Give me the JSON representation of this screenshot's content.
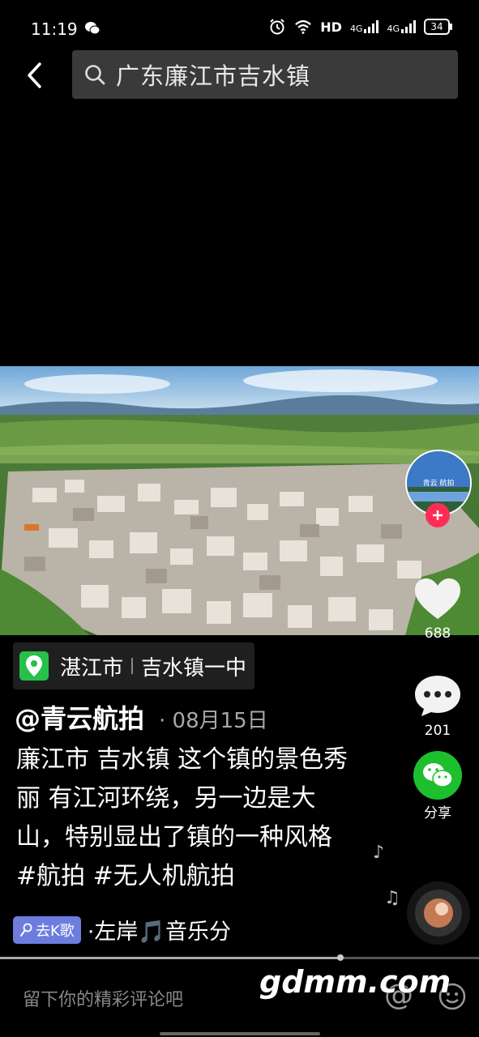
{
  "status_bar": {
    "time": "11:19",
    "hd": "HD",
    "net1": "4G",
    "net2": "4G",
    "battery": "34"
  },
  "search": {
    "query": "广东廉江市吉水镇"
  },
  "video": {
    "avatar_text": "青云 航拍"
  },
  "actions": {
    "like_count": "688",
    "comment_count": "201",
    "share_label": "分享"
  },
  "location": {
    "city": "湛江市",
    "place": "吉水镇一中"
  },
  "post": {
    "author": "@青云航拍",
    "date": "· 08月15日",
    "description": "廉江市 吉水镇 这个镇的景色秀丽 有江河环绕，另一边是大山，特别显出了镇的一种风格 #航拍 #无人机航拍"
  },
  "music": {
    "k_song_label": "去K歌",
    "title": "·左岸🎵音乐分"
  },
  "progress": {
    "fraction": 0.71
  },
  "comment": {
    "placeholder": "留下你的精彩评论吧",
    "at_symbol": "@"
  },
  "watermark": "gdmm.com",
  "colors": {
    "accent_pink": "#ff2d55",
    "wechat_green": "#1dbf2f",
    "location_green": "#27c04a",
    "k_song_purple": "#6d7dde"
  }
}
